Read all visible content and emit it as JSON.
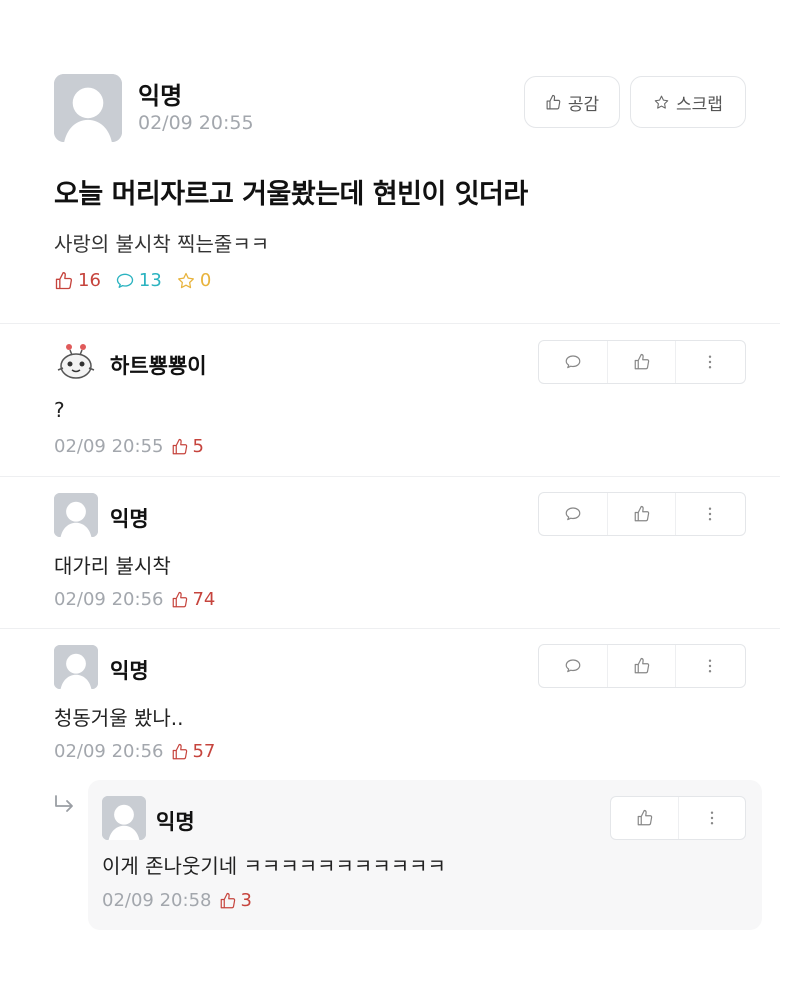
{
  "post": {
    "author": "익명",
    "time": "02/09 20:55",
    "empathy_label": "공감",
    "scrap_label": "스크랩",
    "title": "오늘 머리자르고 거울봤는데 현빈이 잇더라",
    "body": "사랑의 불시착 찍는줄ㅋㅋ",
    "likes": "16",
    "comments": "13",
    "scraps": "0"
  },
  "comments": [
    {
      "author": "하트뿅뿅이",
      "text": "?",
      "time": "02/09 20:55",
      "likes": "5"
    },
    {
      "author": "익명",
      "text": "대가리 불시착",
      "time": "02/09 20:56",
      "likes": "74"
    },
    {
      "author": "익명",
      "text": "청동거울 봤나..",
      "time": "02/09 20:56",
      "likes": "57"
    }
  ],
  "reply": {
    "author": "익명",
    "text": "이게 존나웃기네 ㅋㅋㅋㅋㅋㅋㅋㅋㅋㅋㅋ",
    "time": "02/09 20:58",
    "likes": "3"
  },
  "icons": {
    "thumb": "thumbs-up-icon",
    "comment": "speech-bubble-icon",
    "star": "star-icon",
    "more": "vertical-ellipsis-icon",
    "reply_arrow": "reply-arrow-icon"
  },
  "colors": {
    "like": "#c6443d",
    "comment": "#2bb3c0",
    "scrap": "#e8b33c",
    "muted": "#a3a7ad"
  }
}
